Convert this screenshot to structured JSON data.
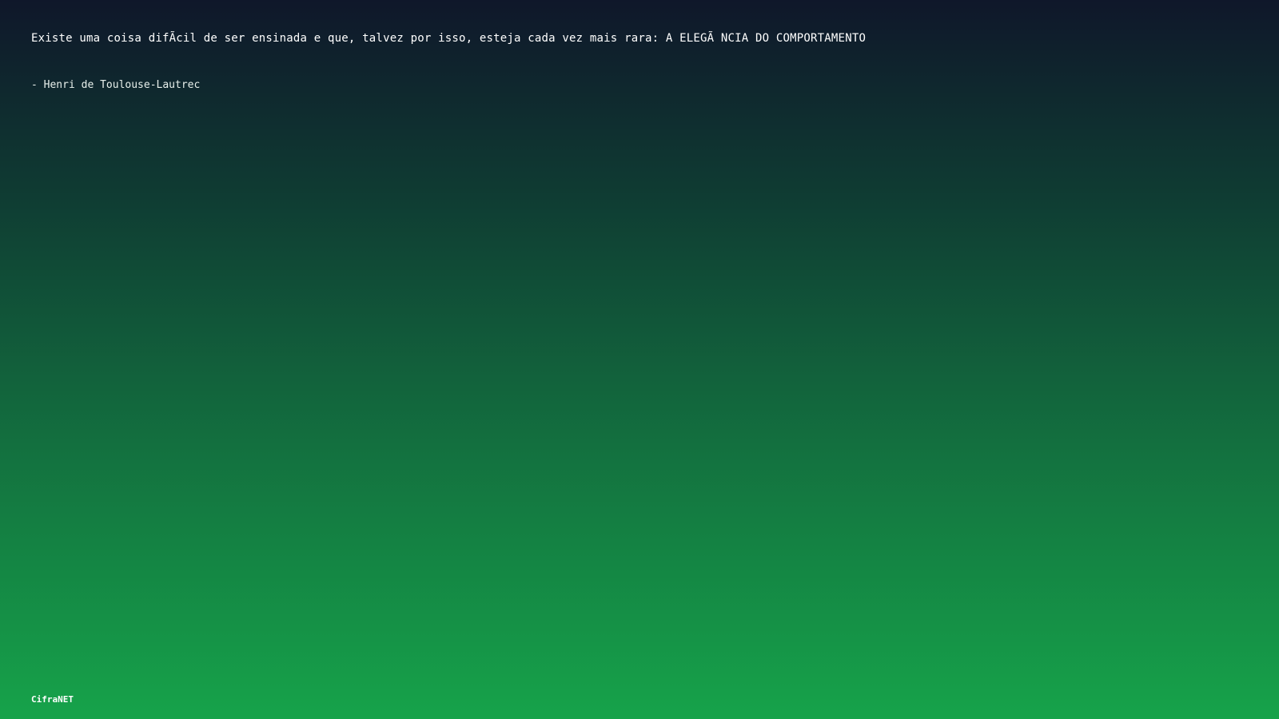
{
  "quote": {
    "text": "Existe uma coisa difÃ­cil de ser ensinada e que, talvez por isso, esteja cada vez mais rara: A ELEGÃ NCIA DO COMPORTAMENTO",
    "author": "- Henri de Toulouse-Lautrec"
  },
  "footer": {
    "brand": "CifraNET"
  },
  "colors": {
    "background_top": "#0f172a",
    "background_bottom": "#16a34a",
    "text": "#ffffff"
  }
}
